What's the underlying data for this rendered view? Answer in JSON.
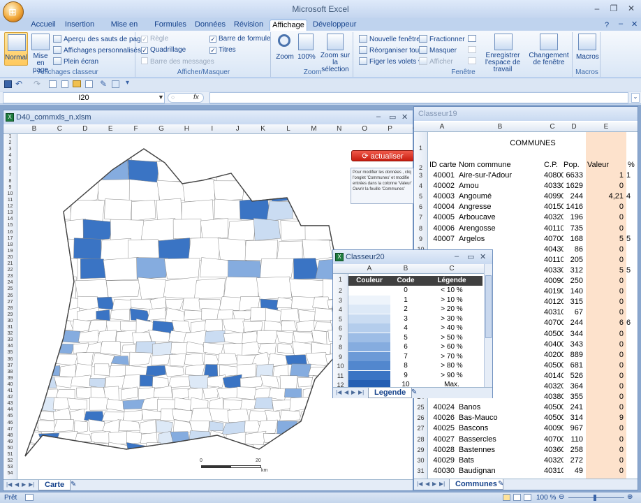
{
  "app": {
    "title": "Microsoft Excel"
  },
  "tabs": [
    "Accueil",
    "Insertion",
    "Mise en page",
    "Formules",
    "Données",
    "Révision",
    "Affichage",
    "Développeur"
  ],
  "active_tab": "Affichage",
  "ribbon": {
    "affichages_classeur": {
      "label": "Affichages classeur",
      "normal": "Normal",
      "mise_en_page": "Mise en page",
      "apercu": "Aperçu des sauts de page",
      "personnalises": "Affichages personnalisés",
      "plein_ecran": "Plein écran"
    },
    "afficher_masquer": {
      "label": "Afficher/Masquer",
      "regle": "Règle",
      "quadrillage": "Quadrillage",
      "barre_messages": "Barre des messages",
      "barre_formule": "Barre de formule",
      "titres": "Titres"
    },
    "zoom": {
      "label": "Zoom",
      "zoom": "Zoom",
      "cent": "100%",
      "zoom_sel": "Zoom sur la sélection"
    },
    "fenetre": {
      "label": "Fenêtre",
      "nouvelle": "Nouvelle fenêtre",
      "reorganiser": "Réorganiser tout",
      "figer": "Figer les volets",
      "fractionner": "Fractionner",
      "masquer": "Masquer",
      "afficher": "Afficher",
      "enregistrer": "Enregistrer l'espace de travail",
      "changer": "Changement de fenêtre"
    },
    "macros": {
      "label": "Macros",
      "macros": "Macros"
    }
  },
  "formula_bar": {
    "name_box": "I20",
    "fx": "fx",
    "value": ""
  },
  "map_window": {
    "title": "D40_commxls_n.xlsm",
    "col_headers": [
      "B",
      "C",
      "D",
      "E",
      "F",
      "G",
      "H",
      "I",
      "J",
      "K",
      "L",
      "M",
      "N",
      "O",
      "P",
      "Q"
    ],
    "row_headers": [
      "1",
      "2",
      "3",
      "4",
      "5",
      "6",
      "7",
      "8",
      "9",
      "10",
      "11",
      "12",
      "13",
      "14",
      "15",
      "16",
      "17",
      "18",
      "19",
      "20",
      "21",
      "22",
      "23",
      "24",
      "25",
      "26",
      "27",
      "28",
      "29",
      "30",
      "31",
      "32",
      "33",
      "34",
      "35",
      "36",
      "37",
      "38",
      "39",
      "40",
      "41",
      "42",
      "43",
      "44",
      "45",
      "46",
      "47",
      "48",
      "49",
      "50",
      "51",
      "52",
      "53",
      "54"
    ],
    "button": "actualiser",
    "info": "Pour modifier les données , cliq l'onglet 'Communes' et modifie entrées dans la colonne 'Valeur' Ouvrir la feuille 'Communes'",
    "scale_start": "0",
    "scale_end": "20",
    "scale_unit": "km",
    "tab": "Carte"
  },
  "communes_window": {
    "title": "Classeur19",
    "col_headers": [
      "A",
      "B",
      "C",
      "D",
      "E"
    ],
    "heading": "COMMUNES",
    "headers": [
      "ID carte",
      "Nom commune",
      "C.P.",
      "Pop.",
      "Valeur",
      "%"
    ],
    "rows": [
      {
        "r": "3",
        "id": "40001",
        "nom": "Aire-sur-l'Adour",
        "cp": "40800",
        "pop": "6633",
        "val": "1",
        "pct": "1"
      },
      {
        "r": "4",
        "id": "40002",
        "nom": "Amou",
        "cp": "40330",
        "pop": "1629",
        "val": "0",
        "pct": ""
      },
      {
        "r": "5",
        "id": "40003",
        "nom": "Angoumé",
        "cp": "40990",
        "pop": "244",
        "val": "4,21",
        "pct": "4"
      },
      {
        "r": "6",
        "id": "40004",
        "nom": "Angresse",
        "cp": "40150",
        "pop": "1416",
        "val": "0",
        "pct": ""
      },
      {
        "r": "7",
        "id": "40005",
        "nom": "Arboucave",
        "cp": "40320",
        "pop": "196",
        "val": "0",
        "pct": ""
      },
      {
        "r": "8",
        "id": "40006",
        "nom": "Arengosse",
        "cp": "40110",
        "pop": "735",
        "val": "0",
        "pct": ""
      },
      {
        "r": "9",
        "id": "40007",
        "nom": "Argelos",
        "cp": "40700",
        "pop": "168",
        "val": "5",
        "pct": "5"
      },
      {
        "r": "10",
        "id": "",
        "nom": "",
        "cp": "40430",
        "pop": "86",
        "val": "0",
        "pct": ""
      },
      {
        "r": "11",
        "id": "",
        "nom": "",
        "cp": "40110",
        "pop": "205",
        "val": "0",
        "pct": ""
      },
      {
        "r": "12",
        "id": "",
        "nom": "",
        "cp": "40330",
        "pop": "312",
        "val": "5",
        "pct": "5"
      },
      {
        "r": "13",
        "id": "",
        "nom": "",
        "cp": "40090",
        "pop": "250",
        "val": "0",
        "pct": ""
      },
      {
        "r": "14",
        "id": "",
        "nom": "rmagnac",
        "cp": "40190",
        "pop": "140",
        "val": "0",
        "pct": ""
      },
      {
        "r": "15",
        "id": "",
        "nom": "",
        "cp": "40120",
        "pop": "315",
        "val": "0",
        "pct": ""
      },
      {
        "r": "16",
        "id": "",
        "nom": "",
        "cp": "40310",
        "pop": "67",
        "val": "0",
        "pct": ""
      },
      {
        "r": "17",
        "id": "",
        "nom": "",
        "cp": "40700",
        "pop": "244",
        "val": "6",
        "pct": "6"
      },
      {
        "r": "18",
        "id": "",
        "nom": "",
        "cp": "40500",
        "pop": "344",
        "val": "0",
        "pct": ""
      },
      {
        "r": "19",
        "id": "",
        "nom": "",
        "cp": "40400",
        "pop": "343",
        "val": "0",
        "pct": ""
      },
      {
        "r": "20",
        "id": "",
        "nom": "",
        "cp": "40200",
        "pop": "889",
        "val": "0",
        "pct": ""
      },
      {
        "r": "21",
        "id": "",
        "nom": "",
        "cp": "40500",
        "pop": "681",
        "val": "0",
        "pct": ""
      },
      {
        "r": "22",
        "id": "",
        "nom": "",
        "cp": "40140",
        "pop": "526",
        "val": "0",
        "pct": ""
      },
      {
        "r": "23",
        "id": "",
        "nom": "biran",
        "cp": "40320",
        "pop": "364",
        "val": "0",
        "pct": ""
      },
      {
        "r": "24",
        "id": "",
        "nom": "",
        "cp": "40380",
        "pop": "355",
        "val": "0",
        "pct": ""
      },
      {
        "r": "25",
        "id": "40024",
        "nom": "Banos",
        "cp": "40500",
        "pop": "241",
        "val": "0",
        "pct": ""
      },
      {
        "r": "26",
        "id": "40026",
        "nom": "Bas-Mauco",
        "cp": "40500",
        "pop": "314",
        "val": "9",
        "pct": ""
      },
      {
        "r": "27",
        "id": "40025",
        "nom": "Bascons",
        "cp": "40090",
        "pop": "967",
        "val": "0",
        "pct": ""
      },
      {
        "r": "28",
        "id": "40027",
        "nom": "Bassercles",
        "cp": "40700",
        "pop": "110",
        "val": "0",
        "pct": ""
      },
      {
        "r": "29",
        "id": "40028",
        "nom": "Bastennes",
        "cp": "40360",
        "pop": "258",
        "val": "0",
        "pct": ""
      },
      {
        "r": "30",
        "id": "40029",
        "nom": "Bats",
        "cp": "40320",
        "pop": "272",
        "val": "0",
        "pct": ""
      },
      {
        "r": "31",
        "id": "40030",
        "nom": "Baudignan",
        "cp": "40310",
        "pop": "49",
        "val": "0",
        "pct": ""
      }
    ],
    "tab": "Communes"
  },
  "legend_window": {
    "title": "Classeur20",
    "col_headers": [
      "A",
      "B",
      "C"
    ],
    "headers": [
      "Couleur",
      "Code",
      "Légende"
    ],
    "rows": [
      {
        "r": "2",
        "code": "0",
        "leg": "< 10 %",
        "color": "#ffffff"
      },
      {
        "r": "3",
        "code": "1",
        "leg": "> 10 %",
        "color": "#eef4fb"
      },
      {
        "r": "4",
        "code": "2",
        "leg": "> 20 %",
        "color": "#dde9f7"
      },
      {
        "r": "5",
        "code": "3",
        "leg": "> 30 %",
        "color": "#cadcf2"
      },
      {
        "r": "6",
        "code": "4",
        "leg": "> 40 %",
        "color": "#b4cdec"
      },
      {
        "r": "7",
        "code": "5",
        "leg": "> 50 %",
        "color": "#9dbde6"
      },
      {
        "r": "8",
        "code": "6",
        "leg": "> 60 %",
        "color": "#85acdf"
      },
      {
        "r": "9",
        "code": "7",
        "leg": "> 70 %",
        "color": "#6c9ad7"
      },
      {
        "r": "10",
        "code": "8",
        "leg": "> 80 %",
        "color": "#5287ce"
      },
      {
        "r": "11",
        "code": "9",
        "leg": "> 90 %",
        "color": "#3a74c4"
      },
      {
        "r": "12",
        "code": "10",
        "leg": "Max.",
        "color": "#245fb3"
      }
    ],
    "tab": "Legende"
  },
  "status": {
    "ready": "Prêt",
    "zoom": "100 %"
  }
}
